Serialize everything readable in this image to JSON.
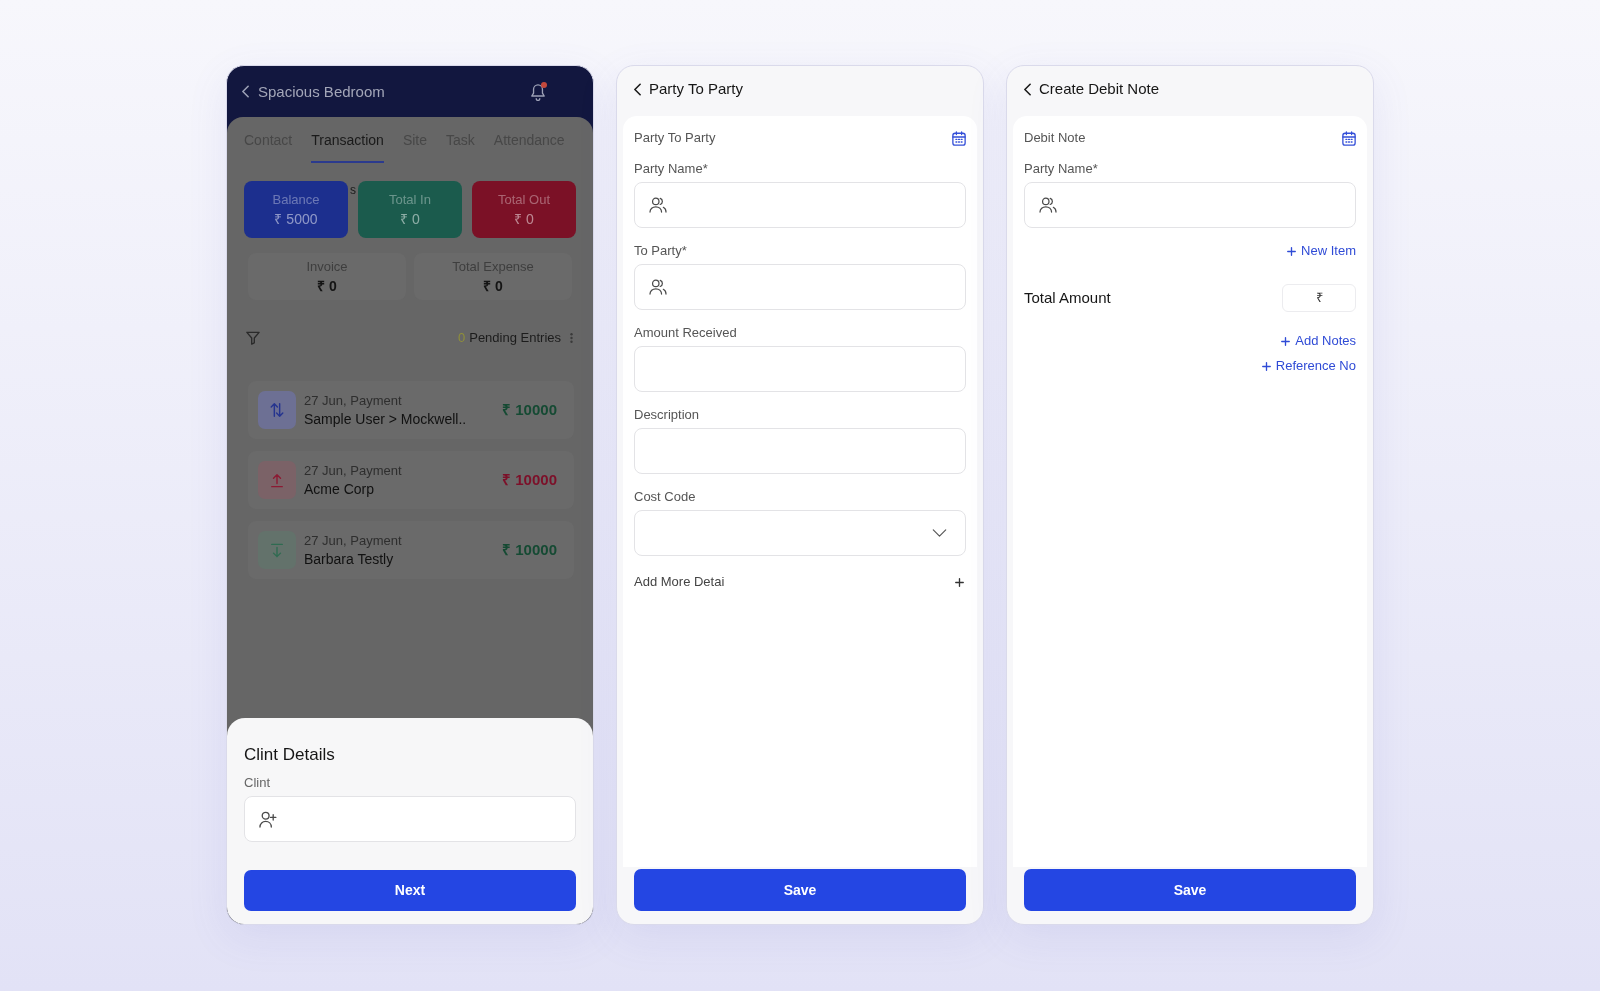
{
  "project_screen": {
    "header": {
      "title": "Spacious Bedroom",
      "notification_dot": true
    },
    "tabs": [
      {
        "label": "Contact",
        "selected": false
      },
      {
        "label": "Transaction",
        "selected": true
      },
      {
        "label": "Site",
        "selected": false
      },
      {
        "label": "Task",
        "selected": false
      },
      {
        "label": "Attendance",
        "selected": false
      }
    ],
    "covered_text": "s",
    "summary_cards": [
      {
        "label": "Balance",
        "value": "₹ 5000",
        "color": "#1c2f8e"
      },
      {
        "label": "Total In",
        "value": "₹ 0",
        "color": "#1b5b4d"
      },
      {
        "label": "Total Out",
        "value": "₹ 0",
        "color": "#7b1126"
      }
    ],
    "totals": [
      {
        "label": "Invoice",
        "value": "₹ 0"
      },
      {
        "label": "Total Expense",
        "value": "₹ 0"
      }
    ],
    "pending": {
      "count": "0",
      "label": "Pending Entries"
    },
    "transactions": [
      {
        "kind": "transfer",
        "date": "27 Jun, Payment",
        "party": "Sample User > Mockwell..",
        "amount": "₹ 10000"
      },
      {
        "kind": "payment_out",
        "date": "27 Jun, Payment",
        "party": "Acme Corp",
        "amount": "₹ 10000"
      },
      {
        "kind": "payment_in",
        "date": "27 Jun, Payment",
        "party": "Barbara Testly",
        "amount": "₹ 10000"
      }
    ],
    "bottom_sheet": {
      "title": "Clint Details",
      "fields": [
        {
          "label": "Clint",
          "kind": "person_add"
        }
      ],
      "button": "Next"
    }
  },
  "party_to_party_form": {
    "title": "Party To Party",
    "form_label": "Party To Party",
    "fields": [
      {
        "label": "Party Name*",
        "kind": "party"
      },
      {
        "label": "To Party*",
        "kind": "party"
      },
      {
        "label": "Amount Received",
        "kind": "text"
      },
      {
        "label": "Description",
        "kind": "text"
      },
      {
        "label": "Cost Code",
        "kind": "select"
      }
    ],
    "more_details": "Add More Detai",
    "button": "Save"
  },
  "debit_note_form": {
    "title": "Create Debit Note",
    "form_label": "Debit Note",
    "fields": [
      {
        "label": "Party Name*",
        "kind": "party"
      }
    ],
    "new_item_link": "New Item",
    "total": {
      "label": "Total Amount",
      "value": "₹"
    },
    "links": [
      "Add Notes",
      "Reference No"
    ],
    "button": "Save"
  }
}
